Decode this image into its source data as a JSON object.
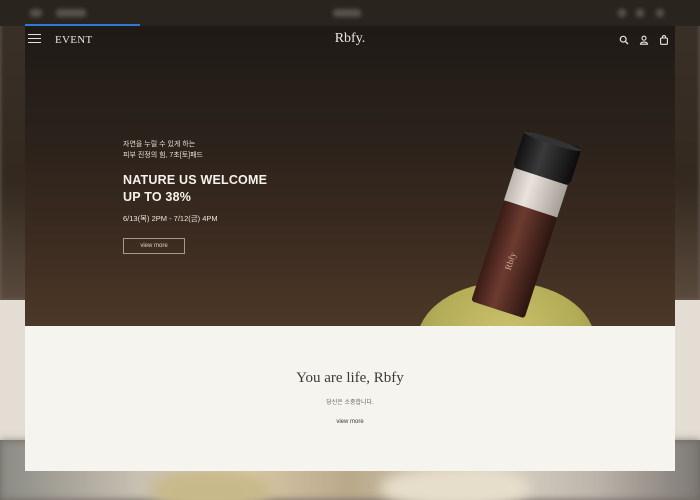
{
  "header": {
    "nav_title": "EVENT",
    "logo": "Rbfy."
  },
  "icons": [
    "hamburger-menu-icon",
    "search-icon",
    "user-icon",
    "shopping-bag-icon"
  ],
  "hero": {
    "subtitle_line1": "자연을 누릴 수 있게 하는",
    "subtitle_line2": "피부 진정의 힘, 7초[토]패드",
    "headline_line1": "NATURE US WELCOME",
    "headline_line2": "UP TO 38%",
    "date": "6/13(목) 2PM - 7/12(금) 4PM",
    "button_label": "view more",
    "bottle_brand": "Rbfy"
  },
  "section": {
    "tagline": "You are life, Rbfy",
    "subtitle": "당신은 소중합니다.",
    "link_label": "view more"
  },
  "colors": {
    "hero_dark": "#1f1a16",
    "hero_light": "#4c3827",
    "panel": "#f6f4ee",
    "accent_progress": "#2d7bd4",
    "stand": "#b4ad58"
  }
}
